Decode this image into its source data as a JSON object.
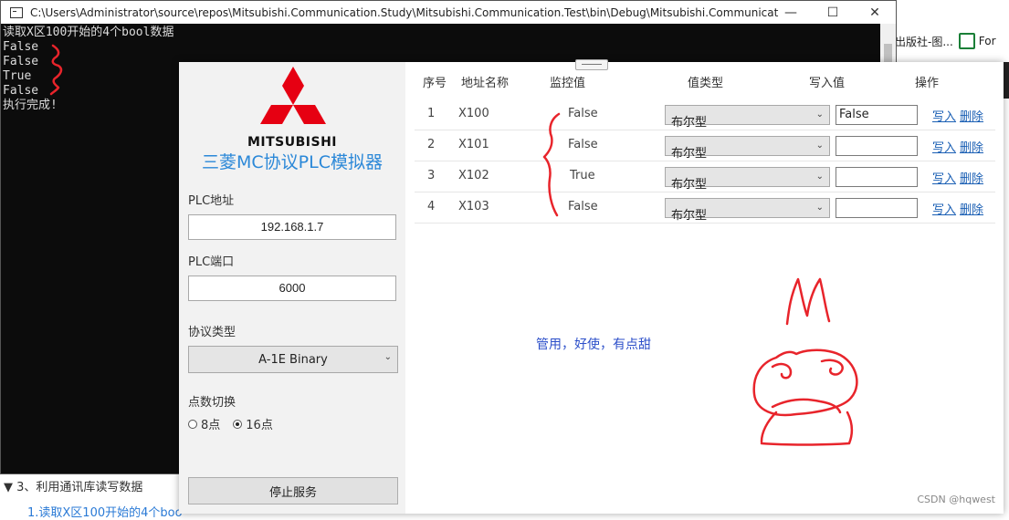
{
  "background": {
    "tab_text": "学出版社-图...",
    "tab2_text": "For",
    "toc_section": "▼ 3、利用通讯库读写数据",
    "toc_item": "1.读取X区100开始的4个boo"
  },
  "console": {
    "title": "C:\\Users\\Administrator\\source\\repos\\Mitsubishi.Communication.Study\\Mitsubishi.Communication.Test\\bin\\Debug\\Mitsubishi.Communicat...",
    "minimize": "—",
    "maximize": "☐",
    "close": "✕",
    "lines": [
      "读取X区100开始的4个bool数据",
      "False",
      "False",
      "True",
      "False",
      "执行完成!"
    ]
  },
  "simulator": {
    "brand": "MITSUBISHI",
    "title": "三菱MC协议PLC模拟器",
    "plc_address_label": "PLC地址",
    "plc_address_value": "192.168.1.7",
    "plc_port_label": "PLC端口",
    "plc_port_value": "6000",
    "protocol_label": "协议类型",
    "protocol_value": "A-1E Binary",
    "points_label": "点数切换",
    "radio_options": [
      "8点",
      "16点"
    ],
    "radio_selected": "16点",
    "stop_button": "停止服务",
    "brand_color": "#e60012",
    "accent_color": "#2b88d8"
  },
  "table": {
    "headers": [
      "序号",
      "地址名称",
      "监控值",
      "值类型",
      "写入值",
      "操作"
    ],
    "rows": [
      {
        "index": "1",
        "address": "X100",
        "monitor": "False",
        "type": "布尔型",
        "write": "False",
        "op_write": "写入",
        "op_delete": "删除"
      },
      {
        "index": "2",
        "address": "X101",
        "monitor": "False",
        "type": "布尔型",
        "write": "",
        "op_write": "写入",
        "op_delete": "删除"
      },
      {
        "index": "3",
        "address": "X102",
        "monitor": "True",
        "type": "布尔型",
        "write": "",
        "op_write": "写入",
        "op_delete": "删除"
      },
      {
        "index": "4",
        "address": "X103",
        "monitor": "False",
        "type": "布尔型",
        "write": "",
        "op_write": "写入",
        "op_delete": "删除"
      }
    ]
  },
  "note": "管用，好使，有点甜",
  "watermark": "CSDN @hqwest"
}
